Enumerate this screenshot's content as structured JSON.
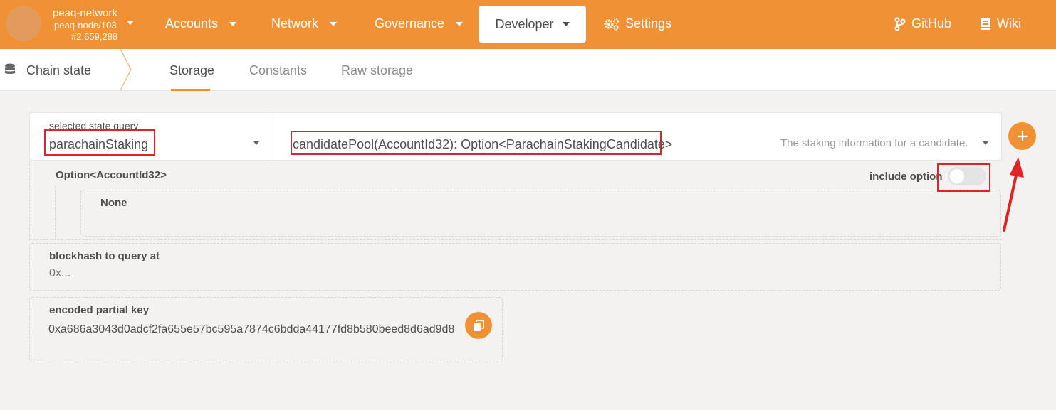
{
  "header": {
    "chain_name": "peaq-network",
    "node_name": "peaq-node/103",
    "block_number": "#2,659,288",
    "nav": {
      "accounts": "Accounts",
      "network": "Network",
      "governance": "Governance",
      "developer": "Developer",
      "settings": "Settings",
      "github": "GitHub",
      "wiki": "Wiki"
    }
  },
  "subnav": {
    "title": "Chain state",
    "tabs": [
      "Storage",
      "Constants",
      "Raw storage"
    ],
    "active_tab": "Storage"
  },
  "query": {
    "label": "selected state query",
    "section": "parachainStaking",
    "method": "candidatePool(AccountId32): Option<ParachainStakingCandidate>",
    "description": "The staking information for a candidate."
  },
  "option": {
    "type_label": "Option<AccountId32>",
    "include_label": "include option",
    "include_enabled": false,
    "value_label": "None"
  },
  "blockhash": {
    "label": "blockhash to query at",
    "placeholder": "0x..."
  },
  "encoded_key": {
    "label": "encoded partial key",
    "value": "0xa686a3043d0adcf2fa655e57bc595a7874c6bdda44177fd8b580beed8d6ad9d8"
  },
  "colors": {
    "brand": "#f19135",
    "annotation": "#d9262b"
  }
}
